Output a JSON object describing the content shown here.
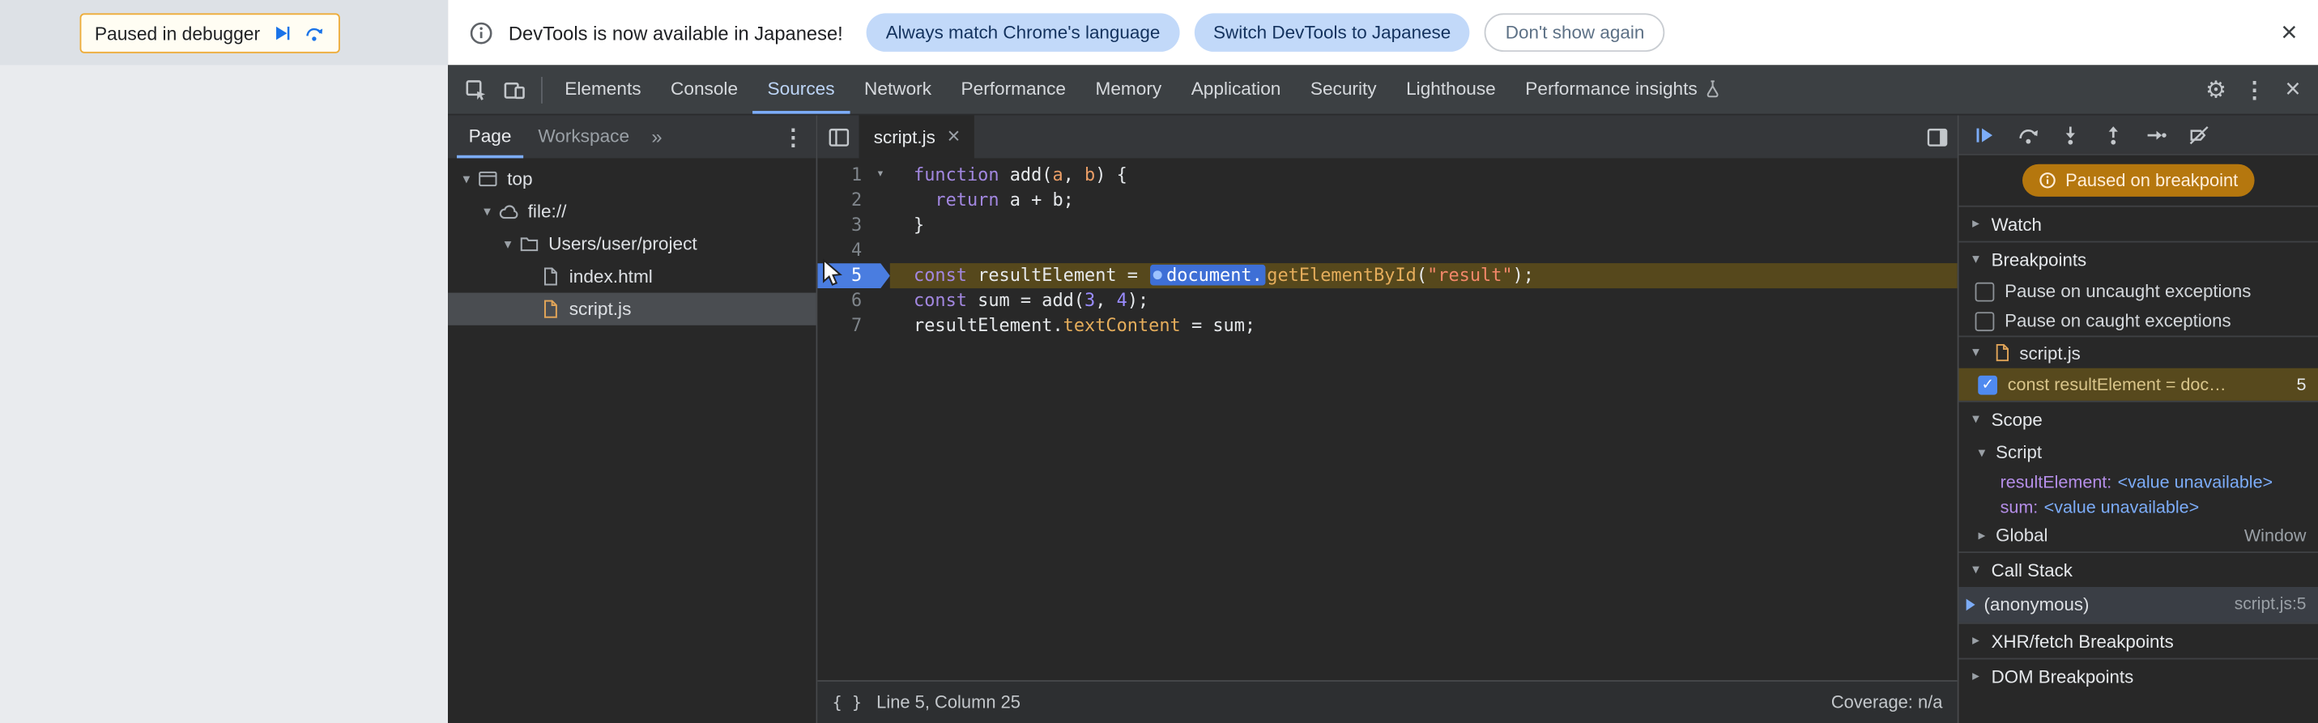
{
  "colors": {
    "accent_blue": "#7cacf8",
    "paused_badge_orange": "#b5770e",
    "paused_line_highlight": "#56481c",
    "selection_blue": "#3e6fd6",
    "breakpoint_row": "#57491d",
    "banner_border": "#eeac38"
  },
  "page": {
    "paused_banner": "Paused in debugger"
  },
  "infobar": {
    "message": "DevTools is now available in Japanese!",
    "btn_match": "Always match Chrome's language",
    "btn_switch": "Switch DevTools to Japanese",
    "btn_dismiss": "Don't show again"
  },
  "toolbar": {
    "tabs": [
      "Elements",
      "Console",
      "Sources",
      "Network",
      "Performance",
      "Memory",
      "Application",
      "Security",
      "Lighthouse",
      "Performance insights"
    ],
    "active_index": 2
  },
  "navigator": {
    "tab_page": "Page",
    "tab_workspace": "Workspace",
    "tree": [
      {
        "label": "top",
        "depth": 0,
        "icon": "frame",
        "expanded": true
      },
      {
        "label": "file://",
        "depth": 1,
        "icon": "cloud",
        "expanded": true
      },
      {
        "label": "Users/user/project",
        "depth": 2,
        "icon": "folder",
        "expanded": true
      },
      {
        "label": "index.html",
        "depth": 3,
        "icon": "file-html"
      },
      {
        "label": "script.js",
        "depth": 3,
        "icon": "file-js",
        "selected": true
      }
    ]
  },
  "editor": {
    "tab_label": "script.js",
    "paused_line": 5,
    "lines": [
      {
        "num": "1",
        "fold": true,
        "tokens": [
          {
            "c": "kw",
            "s": "function"
          },
          {
            "c": "pl",
            "s": " add("
          },
          {
            "c": "def",
            "s": "a"
          },
          {
            "c": "pl",
            "s": ", "
          },
          {
            "c": "def",
            "s": "b"
          },
          {
            "c": "pl",
            "s": ") {"
          }
        ]
      },
      {
        "num": "2",
        "tokens": [
          {
            "c": "pl",
            "s": "  "
          },
          {
            "c": "kw",
            "s": "return"
          },
          {
            "c": "pl",
            "s": " a + b;"
          }
        ]
      },
      {
        "num": "3",
        "tokens": [
          {
            "c": "pl",
            "s": "}"
          }
        ]
      },
      {
        "num": "4",
        "tokens": []
      },
      {
        "num": "5",
        "paused": true,
        "tokens": [
          {
            "c": "kw",
            "s": "const"
          },
          {
            "c": "pl",
            "s": " resultElement = "
          },
          {
            "c": "sel",
            "s": "document."
          },
          {
            "c": "prop",
            "s": "getElementById"
          },
          {
            "c": "pl",
            "s": "("
          },
          {
            "c": "str",
            "s": "\"result\""
          },
          {
            "c": "pl",
            "s": ");"
          }
        ]
      },
      {
        "num": "6",
        "tokens": [
          {
            "c": "kw",
            "s": "const"
          },
          {
            "c": "pl",
            "s": " sum = add("
          },
          {
            "c": "num",
            "s": "3"
          },
          {
            "c": "pl",
            "s": ", "
          },
          {
            "c": "num",
            "s": "4"
          },
          {
            "c": "pl",
            "s": ");"
          }
        ]
      },
      {
        "num": "7",
        "tokens": [
          {
            "c": "pl",
            "s": "resultElement."
          },
          {
            "c": "prop",
            "s": "textContent"
          },
          {
            "c": "pl",
            "s": " = sum;"
          }
        ]
      }
    ],
    "status_left": "Line 5, Column 25",
    "status_right": "Coverage: n/a"
  },
  "debugger": {
    "paused_badge": "Paused on breakpoint",
    "sections": {
      "watch": "Watch",
      "breakpoints": "Breakpoints",
      "scope": "Scope",
      "call_stack": "Call Stack",
      "xhr": "XHR/fetch Breakpoints",
      "dom": "DOM Breakpoints"
    },
    "breakpoint_options": [
      "Pause on uncaught exceptions",
      "Pause on caught exceptions"
    ],
    "breakpoint_group": {
      "file": "script.js",
      "entry_text": "const resultElement = doc…",
      "entry_line": "5",
      "checked": true
    },
    "scope_pane": {
      "script_label": "Script",
      "variables": [
        {
          "name": "resultElement",
          "value": "<value unavailable>"
        },
        {
          "name": "sum",
          "value": "<value unavailable>"
        }
      ],
      "global_label": "Global",
      "global_value": "Window"
    },
    "call_stack_frame": {
      "name": "(anonymous)",
      "location": "script.js:5"
    }
  }
}
